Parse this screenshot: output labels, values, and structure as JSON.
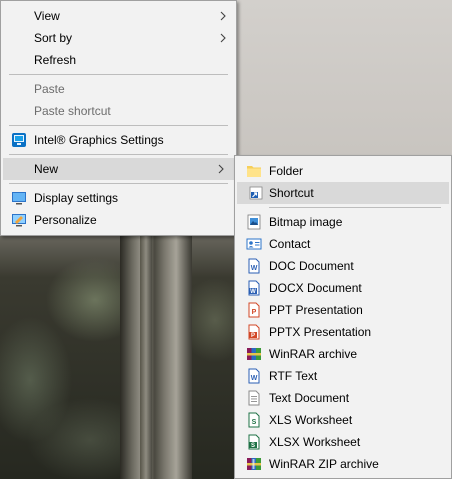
{
  "main_menu": {
    "items": [
      {
        "label": "View",
        "has_submenu": true
      },
      {
        "label": "Sort by",
        "has_submenu": true
      },
      {
        "label": "Refresh"
      },
      {
        "label": "Paste",
        "disabled": true
      },
      {
        "label": "Paste shortcut",
        "disabled": true
      },
      {
        "label": "Intel® Graphics Settings",
        "icon": "intel-graphics-icon"
      },
      {
        "label": "New",
        "has_submenu": true,
        "highlighted": true
      },
      {
        "label": "Display settings",
        "icon": "display-settings-icon"
      },
      {
        "label": "Personalize",
        "icon": "personalize-icon"
      }
    ]
  },
  "new_submenu": {
    "items": [
      {
        "label": "Folder",
        "icon": "folder-icon"
      },
      {
        "label": "Shortcut",
        "icon": "shortcut-icon",
        "highlighted": true
      },
      {
        "label": "Bitmap image",
        "icon": "bitmap-icon"
      },
      {
        "label": "Contact",
        "icon": "contact-icon"
      },
      {
        "label": "DOC Document",
        "icon": "word-doc-icon"
      },
      {
        "label": "DOCX Document",
        "icon": "word-docx-icon"
      },
      {
        "label": "PPT Presentation",
        "icon": "ppt-icon"
      },
      {
        "label": "PPTX Presentation",
        "icon": "pptx-icon"
      },
      {
        "label": "WinRAR archive",
        "icon": "winrar-icon"
      },
      {
        "label": "RTF Text",
        "icon": "rtf-icon"
      },
      {
        "label": "Text Document",
        "icon": "text-doc-icon"
      },
      {
        "label": "XLS Worksheet",
        "icon": "xls-icon"
      },
      {
        "label": "XLSX Worksheet",
        "icon": "xlsx-icon"
      },
      {
        "label": "WinRAR ZIP archive",
        "icon": "winrar-zip-icon"
      }
    ]
  },
  "colors": {
    "menu_bg": "#f2f2f2",
    "highlight_bg": "#d9d9d9",
    "disabled_text": "#6d6d6d",
    "word_blue": "#2b5fb4",
    "ppt_orange": "#d24726",
    "excel_green": "#1e7145"
  }
}
